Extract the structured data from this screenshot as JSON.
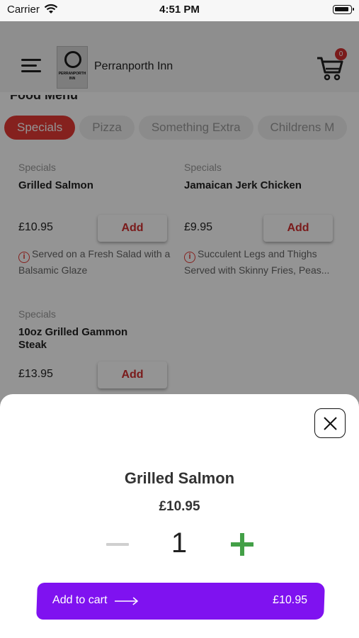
{
  "status_bar": {
    "carrier": "Carrier",
    "time": "4:51 PM"
  },
  "header": {
    "restaurant_name": "Perranporth Inn",
    "logo_line1": "PERRANPORTH",
    "logo_line2": "INN",
    "cart_count": "0"
  },
  "menu": {
    "heading": "Food Menu",
    "tabs": [
      {
        "label": "Specials",
        "active": true
      },
      {
        "label": "Pizza",
        "active": false
      },
      {
        "label": "Something Extra",
        "active": false
      },
      {
        "label": "Childrens M",
        "active": false
      }
    ],
    "items": [
      {
        "category": "Specials",
        "name": "Grilled Salmon",
        "price": "£10.95",
        "add_label": "Add",
        "desc": "Served on a Fresh Salad with a Balsamic Glaze"
      },
      {
        "category": "Specials",
        "name": "Jamaican Jerk Chicken",
        "price": "£9.95",
        "add_label": "Add",
        "desc": "Succulent Legs and Thighs Served with Skinny Fries, Peas..."
      },
      {
        "category": "Specials",
        "name": "10oz Grilled Gammon Steak",
        "price": "£13.95",
        "add_label": "Add"
      }
    ]
  },
  "sheet": {
    "title": "Grilled Salmon",
    "price": "£10.95",
    "quantity": "1",
    "add_to_cart_label": "Add to cart",
    "total": "£10.95"
  },
  "colors": {
    "accent_red": "#e53935",
    "purple": "#7f12f0",
    "green": "#43a047"
  }
}
